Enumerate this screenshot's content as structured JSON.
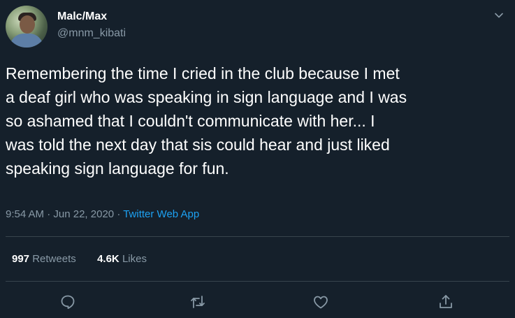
{
  "user": {
    "display_name": "Malc/Max",
    "handle": "@mnm_kibati"
  },
  "tweet": {
    "text": "Remembering the time I cried in the club because I met\na deaf girl who was speaking in sign language and I was\nso ashamed that I couldn't communicate with her... I\nwas told the next day that sis could hear and just liked\nspeaking sign language for fun."
  },
  "meta": {
    "time": "9:54 AM",
    "separator1": "·",
    "date": "Jun 22, 2020",
    "separator2": "·",
    "source": "Twitter Web App"
  },
  "stats": {
    "retweets_count": "997",
    "retweets_label": "Retweets",
    "likes_count": "4.6K",
    "likes_label": "Likes"
  },
  "icons": {
    "menu": "chevron-down-icon",
    "reply": "reply-icon",
    "retweet": "retweet-icon",
    "like": "heart-icon",
    "share": "share-icon"
  },
  "colors": {
    "background": "#15202b",
    "text": "#ffffff",
    "secondary": "#8899a6",
    "accent": "#1da1f2",
    "divider": "#38444d"
  }
}
